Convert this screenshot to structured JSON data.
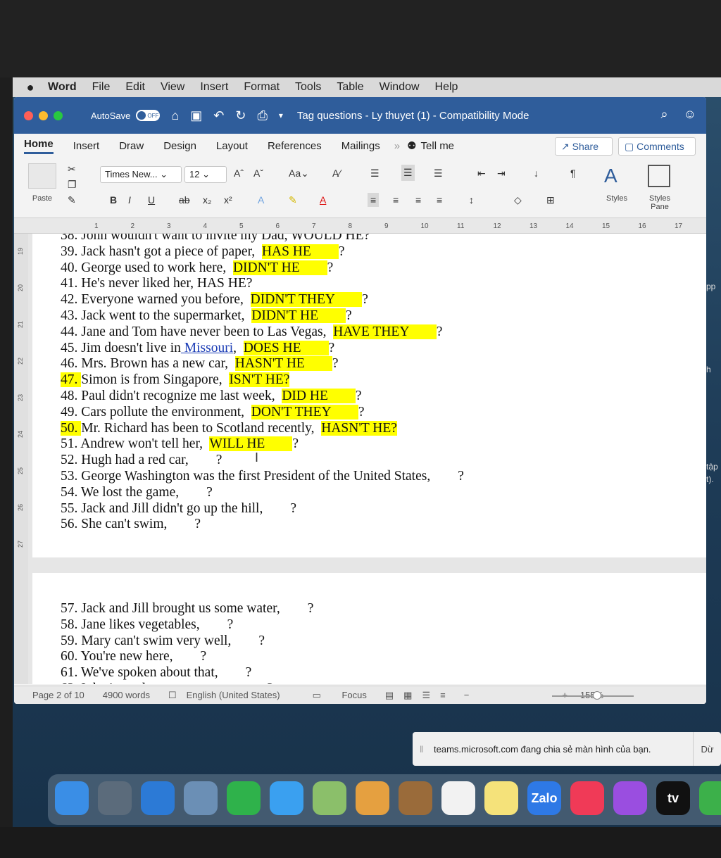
{
  "menubar": {
    "apple": "",
    "items": [
      "Word",
      "File",
      "Edit",
      "View",
      "Insert",
      "Format",
      "Tools",
      "Table",
      "Window",
      "Help"
    ]
  },
  "titlebar": {
    "autosave": "AutoSave",
    "toggle": "OFF",
    "title": "Tag questions - Ly thuyet (1)  -  Compatibility Mode"
  },
  "tabs": [
    "Home",
    "Insert",
    "Draw",
    "Design",
    "Layout",
    "References",
    "Mailings"
  ],
  "tell_me": "Tell me",
  "share": "Share",
  "comments": "Comments",
  "ribbon": {
    "font": "Times New...",
    "size": "12",
    "paste": "Paste",
    "styles": "Styles",
    "styles_pane": "Styles Pane"
  },
  "ruler_ticks": [
    "1",
    "2",
    "3",
    "4",
    "5",
    "6",
    "7",
    "8",
    "9",
    "10",
    "11",
    "12",
    "13",
    "14",
    "15",
    "16",
    "17"
  ],
  "vruler_ticks": [
    "19",
    "20",
    "21",
    "22",
    "23",
    "24",
    "25",
    "26",
    "27"
  ],
  "lines_page1": [
    {
      "num": "38.",
      "text": "John wouldn't want to invite my Dad, WOULD HE?"
    },
    {
      "num": "39.",
      "text": "Jack hasn't got a piece of paper,",
      "answer": "HAS HE",
      "q": "?"
    },
    {
      "num": "40.",
      "text": "George used to work here,",
      "answer": "DIDN'T HE",
      "q": "?"
    },
    {
      "num": "41.",
      "text": "He's never liked her, HAS HE?"
    },
    {
      "num": "42.",
      "text": "Everyone warned you before,",
      "answer": "DIDN'T THEY",
      "q": "?"
    },
    {
      "num": "43.",
      "text": "Jack went to the supermarket,",
      "answer": "DIDN'T HE",
      "q": "?"
    },
    {
      "num": "44.",
      "text": "Jane and Tom have never been to Las Vegas,",
      "answer": "HAVE THEY",
      "q": "?"
    },
    {
      "num": "45.",
      "text": "Jim doesn't live in",
      "link": "Missouri",
      "answer": "DOES HE",
      "q": "?"
    },
    {
      "num": "46.",
      "text": "Mrs. Brown has a new car,",
      "answer": "HASN'T HE",
      "q": "?"
    },
    {
      "num": "47.",
      "text": "Simon is from Singapore,",
      "answer": "ISN'T HE?"
    },
    {
      "num": "48.",
      "text": "Paul didn't recognize me last week,",
      "answer": "DID HE",
      "q": "?"
    },
    {
      "num": "49.",
      "text": "Cars pollute the environment,",
      "answer": "DON'T THEY",
      "q": "?"
    },
    {
      "num": "50.",
      "text": "Mr. Richard has been to Scotland recently,",
      "answer": "HASN'T HE?"
    },
    {
      "num": "51.",
      "text": "Andrew won't tell her,",
      "answer": "WILL HE",
      "q": "?"
    },
    {
      "num": "52.",
      "text": "Hugh had a red car,",
      "q": "?"
    },
    {
      "num": "53.",
      "text": "George Washington was the first President of the United States,",
      "q": "?"
    },
    {
      "num": "54.",
      "text": "We lost the game,",
      "q": "?"
    },
    {
      "num": "55.",
      "text": "Jack and Jill didn't go up the hill,",
      "q": "?"
    },
    {
      "num": "56.",
      "text": "She can't swim,",
      "q": "?"
    }
  ],
  "lines_page2": [
    {
      "num": "57.",
      "text": "Jack and Jill brought us some water,",
      "q": "?"
    },
    {
      "num": "58.",
      "text": "Jane likes vegetables,",
      "q": "?"
    },
    {
      "num": "59.",
      "text": "Mary can't swim very well,",
      "q": "?"
    },
    {
      "num": "60.",
      "text": "You're new here,",
      "q": "?"
    },
    {
      "num": "61.",
      "text": "We've spoken about that,",
      "q": "?"
    },
    {
      "num": "62.",
      "text": "I don't need to say any more,",
      "q": "?"
    }
  ],
  "status": {
    "page": "Page 2 of 10",
    "words": "4900 words",
    "lang": "English (United States)",
    "focus": "Focus",
    "zoom": "155%"
  },
  "notification": {
    "text": "teams.microsoft.com đang chia sẻ màn hình của bạn.",
    "stop": "Dừ"
  },
  "side_peek": [
    "pp",
    "h",
    "tập",
    "t)."
  ],
  "dock": [
    {
      "name": "finder",
      "color": "#3a8ee6",
      "label": ""
    },
    {
      "name": "launchpad",
      "color": "#5b6b7b",
      "label": ""
    },
    {
      "name": "safari",
      "color": "#2c7ad6",
      "label": ""
    },
    {
      "name": "preview",
      "color": "#6b8fb5",
      "label": ""
    },
    {
      "name": "facetime",
      "color": "#2fb24b",
      "label": ""
    },
    {
      "name": "messages",
      "color": "#3aa0f0",
      "label": ""
    },
    {
      "name": "maps",
      "color": "#8bbf6a",
      "label": ""
    },
    {
      "name": "photos",
      "color": "#e5a040",
      "label": ""
    },
    {
      "name": "notebook",
      "color": "#9a6b3a",
      "label": ""
    },
    {
      "name": "reminders",
      "color": "#f2f2f2",
      "label": ""
    },
    {
      "name": "notes",
      "color": "#f5e27a",
      "label": ""
    },
    {
      "name": "zalo",
      "color": "#2e79e6",
      "label": "Zalo"
    },
    {
      "name": "music",
      "color": "#f03a57",
      "label": ""
    },
    {
      "name": "podcasts",
      "color": "#9a4ee0",
      "label": ""
    },
    {
      "name": "tv",
      "color": "#111111",
      "label": "tv"
    },
    {
      "name": "numbers",
      "color": "#3cb04a",
      "label": ""
    }
  ]
}
